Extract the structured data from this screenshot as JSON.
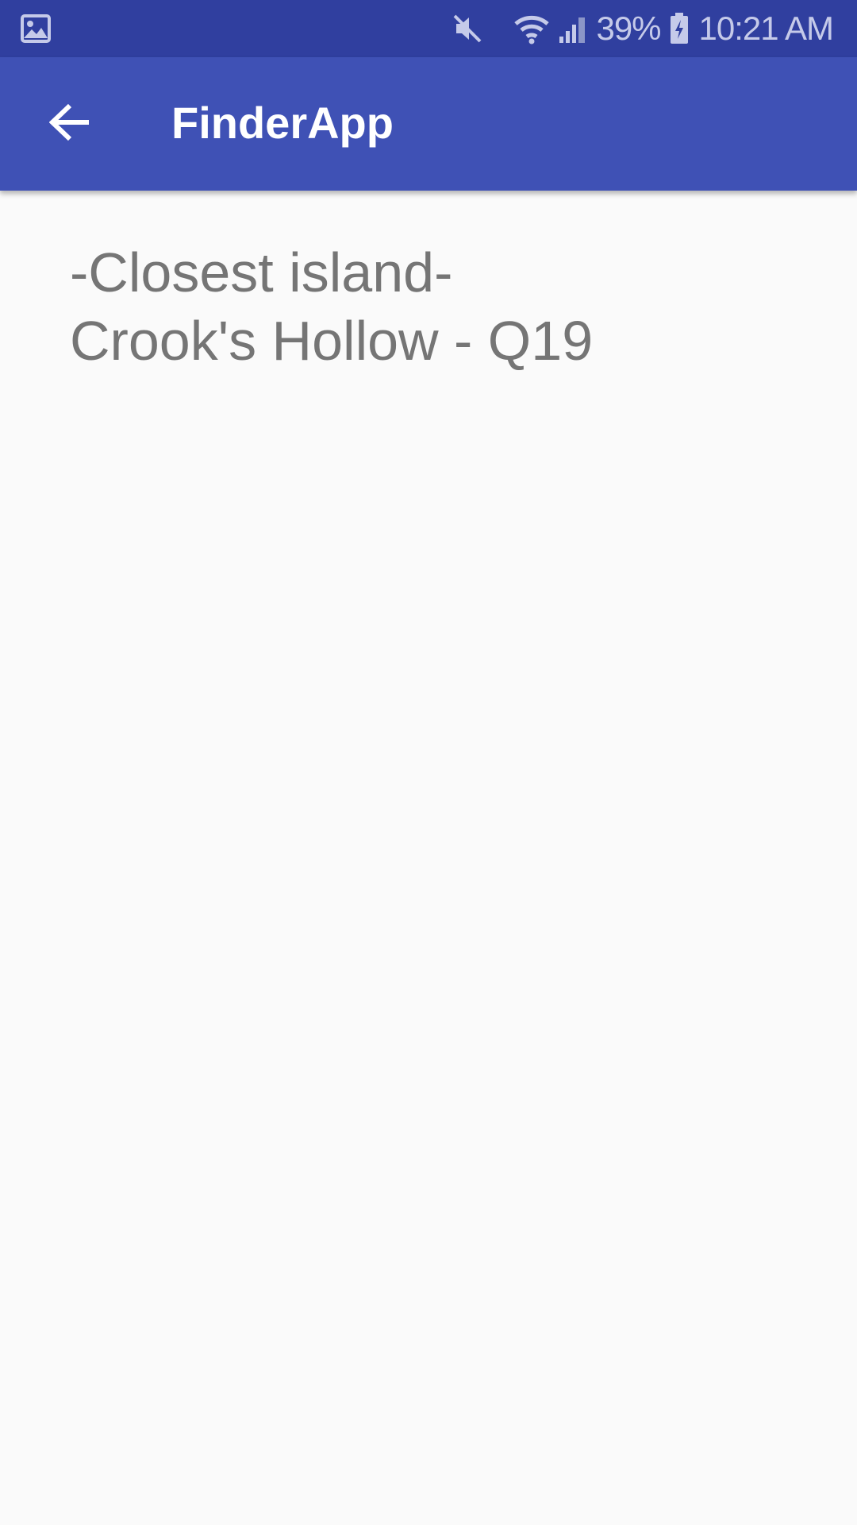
{
  "status_bar": {
    "notification_icon": "image-icon",
    "icons": [
      "mute-icon",
      "wifi-icon",
      "signal-icon",
      "battery-charging-icon"
    ],
    "battery_percent": "39%",
    "time": "10:21 AM"
  },
  "app_bar": {
    "back_icon": "arrow-back-icon",
    "title": "FinderApp"
  },
  "main": {
    "heading": "-Closest island-",
    "result": "Crook's Hollow - Q19"
  },
  "colors": {
    "status_bar": "#303f9f",
    "app_bar": "#3f51b5",
    "background": "#fafafa",
    "text": "#757575"
  }
}
